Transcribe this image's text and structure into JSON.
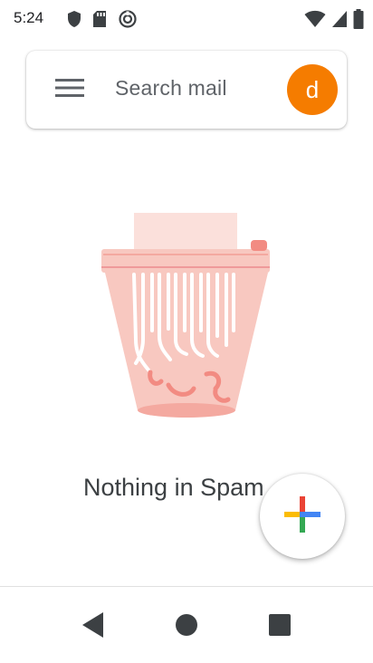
{
  "status_bar": {
    "time": "5:24",
    "left_icons": [
      "shield-icon",
      "sd-card-icon",
      "sync-icon"
    ],
    "right_icons": [
      "wifi-icon",
      "cell-signal-icon",
      "battery-icon"
    ]
  },
  "search_bar": {
    "menu_icon": "hamburger-menu-icon",
    "placeholder": "Search mail",
    "avatar_letter": "d",
    "avatar_color": "#f57c00"
  },
  "empty_state": {
    "illustration": "shredder-trash-icon",
    "message": "Nothing in Spam"
  },
  "compose": {
    "icon": "plus-icon",
    "colors": [
      "#ea4335",
      "#fbbc04",
      "#34a853",
      "#4285f4"
    ]
  },
  "nav_bar": {
    "buttons": [
      "back-icon",
      "home-icon",
      "recents-icon"
    ]
  }
}
